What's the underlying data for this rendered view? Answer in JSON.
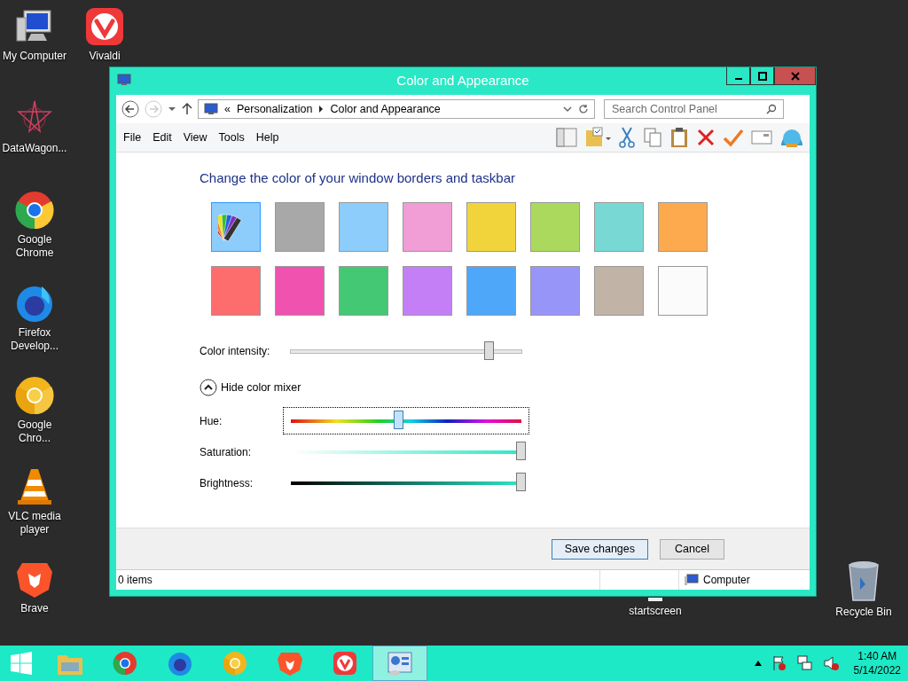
{
  "desktop_icons": [
    {
      "label": "My Computer"
    },
    {
      "label": "Vivaldi"
    },
    {
      "label": "DataWagon..."
    },
    {
      "label": "Google Chrome"
    },
    {
      "label": "Firefox Develop..."
    },
    {
      "label": "Google Chro..."
    },
    {
      "label": "VLC media player"
    },
    {
      "label": "Brave"
    },
    {
      "label": "startscreen"
    },
    {
      "label": "Recycle Bin"
    }
  ],
  "window": {
    "title": "Color and Appearance",
    "address": {
      "prefix": "«",
      "crumbs": [
        "Personalization",
        "Color and Appearance"
      ]
    },
    "search": {
      "placeholder": "Search Control Panel"
    },
    "menu": [
      "File",
      "Edit",
      "View",
      "Tools",
      "Help"
    ],
    "heading": "Change the color of your window borders and taskbar",
    "swatches": [
      {
        "kind": "custom",
        "selected": true
      },
      {
        "kind": "color",
        "color": "#a8a8a8",
        "selected": false
      },
      {
        "kind": "color",
        "color": "#8ccdfc",
        "selected": false
      },
      {
        "kind": "color",
        "color": "#f19dd6",
        "selected": false
      },
      {
        "kind": "color",
        "color": "#f1d43c",
        "selected": false
      },
      {
        "kind": "color",
        "color": "#abd95d",
        "selected": false
      },
      {
        "kind": "color",
        "color": "#78d9d4",
        "selected": false
      },
      {
        "kind": "color",
        "color": "#fdaa4f",
        "selected": false
      },
      {
        "kind": "color",
        "color": "#fe6d6d",
        "selected": false
      },
      {
        "kind": "color",
        "color": "#f052b0",
        "selected": false
      },
      {
        "kind": "color",
        "color": "#44c873",
        "selected": false
      },
      {
        "kind": "color",
        "color": "#c47ff6",
        "selected": false
      },
      {
        "kind": "color",
        "color": "#4fa7f9",
        "selected": false
      },
      {
        "kind": "color",
        "color": "#9895f9",
        "selected": false
      },
      {
        "kind": "color",
        "color": "#c2b3a7",
        "selected": false
      },
      {
        "kind": "color",
        "color": "#fbfbfb",
        "selected": false
      }
    ],
    "intensity": {
      "label": "Color intensity:",
      "level": 0.86
    },
    "mixer_toggle": "Hide color mixer",
    "mixer": [
      {
        "kind": "hue",
        "label": "Hue:",
        "level": 0.47
      },
      {
        "kind": "saturation",
        "label": "Saturation:",
        "level": 1
      },
      {
        "kind": "brightness",
        "label": "Brightness:",
        "level": 1
      }
    ],
    "buttons": [
      "Save changes",
      "Cancel"
    ],
    "status_bar": {
      "items": "0 items",
      "location": "Computer"
    }
  },
  "taskbar": {
    "apps": [
      {
        "selected": false
      },
      {
        "selected": false
      },
      {
        "selected": false
      },
      {
        "selected": false
      },
      {
        "selected": false
      },
      {
        "selected": false
      },
      {
        "selected": true
      }
    ],
    "time": "1:40 AM",
    "date": "5/14/2022"
  }
}
